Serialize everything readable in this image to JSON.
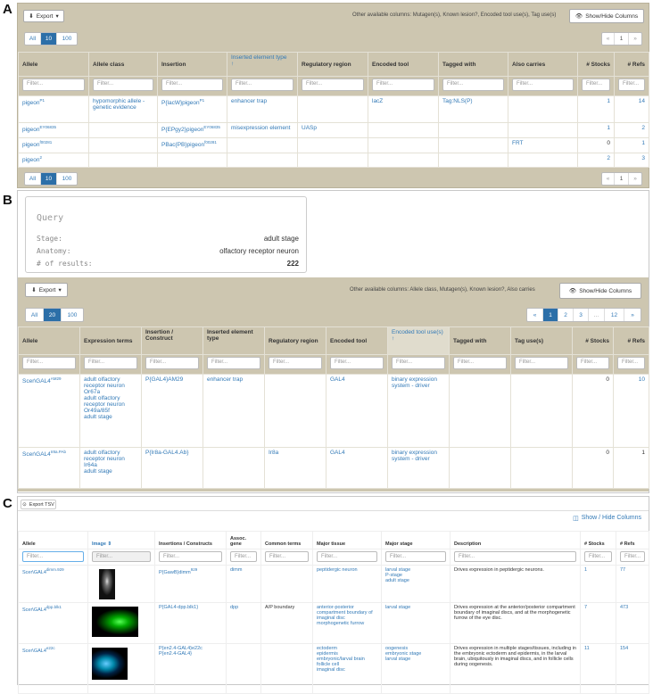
{
  "labels": {
    "a": "A",
    "b": "B",
    "c": "C"
  },
  "a": {
    "export": "Export",
    "show_hide": "Show/Hide Columns",
    "note": "Other available columns: Mutagen(s), Known lesion?, Encoded tool use(s), Tag use(s)",
    "page_sizes": [
      "All",
      "10",
      "100"
    ],
    "pager": [
      "«",
      "1",
      "»"
    ],
    "headers": [
      "Allele",
      "Allele class",
      "Insertion",
      "Inserted element type",
      "Regulatory region",
      "Encoded tool",
      "Tagged with",
      "Also carries",
      "# Stocks",
      "# Refs"
    ],
    "filter": "Filter...",
    "rows": [
      {
        "allele": "pigeon",
        "sup": "P1",
        "class": "hypomorphic allele - genetic evidence",
        "ins": "P{lacW}pigeon",
        "ins_sup": "P1",
        "type": "enhancer trap",
        "reg": "",
        "tool": "lacZ",
        "tag": "Tag:NLS(P)",
        "also": "",
        "stocks": "1",
        "refs": "14"
      },
      {
        "allele": "pigeon",
        "sup": "EY06835",
        "class": "",
        "ins": "P{EPgy2}pigeon",
        "ins_sup": "EY06835",
        "type": "misexpression element",
        "reg": "UASp",
        "tool": "",
        "tag": "",
        "also": "",
        "stocks": "1",
        "refs": "2"
      },
      {
        "allele": "pigeon",
        "sup": "f00281",
        "class": "",
        "ins": "PBac{PB}pigeon",
        "ins_sup": "f00281",
        "type": "",
        "reg": "",
        "tool": "",
        "tag": "",
        "also": "FRT",
        "stocks": "0",
        "refs": "1"
      },
      {
        "allele": "pigeon",
        "sup": "2",
        "class": "",
        "ins": "",
        "ins_sup": "",
        "type": "",
        "reg": "",
        "tool": "",
        "tag": "",
        "also": "",
        "stocks": "2",
        "refs": "3"
      }
    ]
  },
  "b": {
    "query_title": "Query",
    "query": [
      {
        "k": "Stage:",
        "v": "adult stage"
      },
      {
        "k": "Anatomy:",
        "v": "olfactory receptor neuron"
      },
      {
        "k": "# of results:",
        "v": "222"
      }
    ],
    "export": "Export",
    "show_hide": "Show/Hide Columns",
    "note": "Other available columns: Allele class, Mutagen(s), Known lesion?, Also carries",
    "page_sizes": [
      "All",
      "20",
      "100"
    ],
    "pager": [
      "«",
      "1",
      "2",
      "3",
      "...",
      "12",
      "»"
    ],
    "headers": [
      "Allele",
      "Expression terms",
      "Insertion / Construct",
      "Inserted element type",
      "Regulatory region",
      "Encoded tool",
      "Encoded tool use(s)",
      "Tagged with",
      "Tag use(s)",
      "# Stocks",
      "# Refs"
    ],
    "filter": "Filter...",
    "rows": [
      {
        "allele": "Scer\\GAL4",
        "sup": "AM29",
        "expr": [
          "adult olfactory receptor neuron Or67a",
          "adult olfactory receptor neuron Or49a/85f",
          "adult stage"
        ],
        "ins": "P{GAL4}AM29",
        "type": "enhancer trap",
        "reg": "",
        "tool": "GAL4",
        "use": "binary expression system - driver",
        "tag": "",
        "taguse": "",
        "stocks": "0",
        "refs": "10"
      },
      {
        "allele": "Scer\\GAL4",
        "sup": "Ir8a.PAb",
        "expr": [
          "adult olfactory receptor neuron Ir64a",
          "adult stage"
        ],
        "ins": "P{Ir8a-GAL4.Ab}",
        "type": "",
        "reg": "Ir8a",
        "tool": "GAL4",
        "use": "binary expression system - driver",
        "tag": "",
        "taguse": "",
        "stocks": "0",
        "refs": "1"
      }
    ]
  },
  "c": {
    "export": "Export TSV",
    "show_hide": "Show / Hide Columns",
    "headers": [
      "Allele",
      "Image",
      "Insertions / Constructs",
      "Assoc. gene",
      "Common terms",
      "Major tissue",
      "Major stage",
      "Description",
      "# Stocks",
      "# Refs"
    ],
    "filter": "Filter...",
    "rows": [
      {
        "allele": "Scer\\GAL4",
        "sup": "dimm.929",
        "ins": "P{GawB}dimm",
        "ins_sup": "929",
        "gene": "dimm",
        "common": "",
        "tissue": [
          "peptidergic neuron"
        ],
        "stage": [
          "larval stage",
          "P-stage",
          "adult stage"
        ],
        "desc": "Drives expression in peptidergic neurons.",
        "stocks": "1",
        "refs": "77"
      },
      {
        "allele": "Scer\\GAL4",
        "sup": "dpp.blk1",
        "ins": "P{GAL4-dpp.blk1}",
        "ins_sup": "",
        "gene": "dpp",
        "common": "A/P boundary",
        "tissue": [
          "anterior-posterior compartment boundary of imaginal disc",
          "morphogenetic furrow"
        ],
        "stage": [
          "larval stage"
        ],
        "desc": "Drives expression at the anterior/posterior compartment boundary of imaginal discs, and at the morphogenetic furrow of the eye disc.",
        "stocks": "7",
        "refs": "473"
      },
      {
        "allele": "Scer\\GAL4",
        "sup": "e22c",
        "ins": "P{en2.4-GAL4}e22c",
        "ins2": "P{en2.4-GAL4}",
        "ins_sup": "",
        "gene": "",
        "common": "",
        "tissue": [
          "ectoderm",
          "epidermis",
          "embryonic/larval brain",
          "follicle cell",
          "imaginal disc"
        ],
        "stage": [
          "oogenesis",
          "embryonic stage",
          "larval stage"
        ],
        "desc": "Drives expression in multiple stages/tissues, including in the embryonic ectoderm and epidermis, in the larval brain, ubiquitously in imaginal discs, and in follicle cells during oogenesis.",
        "stocks": "11",
        "refs": "154"
      }
    ]
  }
}
